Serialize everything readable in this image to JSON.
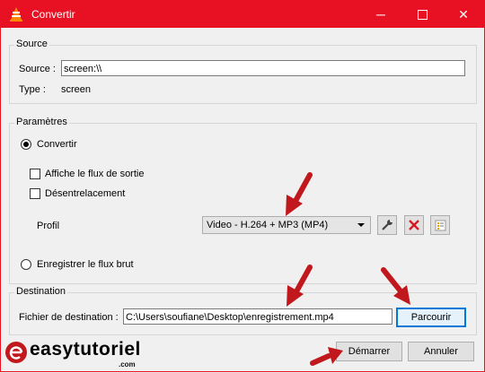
{
  "window": {
    "title": "Convertir",
    "buttons": {
      "minimize": "─",
      "close": "✕"
    }
  },
  "source_group": {
    "title": "Source",
    "source_label": "Source :",
    "source_value": "screen:\\\\",
    "type_label": "Type :",
    "type_value": "screen"
  },
  "settings_group": {
    "title": "Paramètres",
    "convert_label": "Convertir",
    "convert_selected": true,
    "show_output_label": "Affiche le flux de sortie",
    "show_output_checked": false,
    "deinterlace_label": "Désentrelacement",
    "deinterlace_checked": false,
    "profile_label": "Profil",
    "profile_selected": "Video - H.264 + MP3 (MP4)",
    "profile_tools": [
      "wrench-icon",
      "delete-icon",
      "new-profile-icon"
    ],
    "dump_raw_label": "Enregistrer le flux brut",
    "dump_raw_selected": false
  },
  "destination_group": {
    "title": "Destination",
    "file_label": "Fichier de destination :",
    "file_value": "C:\\Users\\soufiane\\Desktop\\enregistrement.mp4",
    "browse_label": "Parcourir"
  },
  "footer": {
    "start_label": "Démarrer",
    "cancel_label": "Annuler"
  },
  "watermark": {
    "text": "easytutoriel",
    "suffix": ".com"
  },
  "colors": {
    "titlebar": "#e81123",
    "annotation_arrow": "#c0181c",
    "focus_border": "#0078d7"
  }
}
